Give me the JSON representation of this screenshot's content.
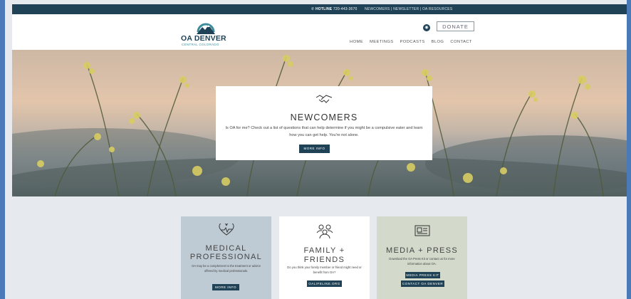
{
  "colors": {
    "navy": "#1f4257",
    "teal": "#3d8c9c",
    "frame": "#4a7ab8"
  },
  "topbar": {
    "hotline_label": "HOTLINE",
    "hotline_number": "720-443-3670",
    "links": [
      "NEWCOMERS",
      "NEWSLETTER",
      "OA RESOURCES"
    ],
    "separator": "|"
  },
  "header": {
    "logo_title": "OA DENVER",
    "logo_subtitle": "CENTRAL COLORADO",
    "donate_label": "DONATE",
    "nav": [
      "HOME",
      "MEETINGS",
      "PODCASTS",
      "BLOG",
      "CONTACT"
    ],
    "rss_icon": "rss-icon"
  },
  "hero": {
    "icon": "handshake-icon",
    "title": "NEWCOMERS",
    "text": "Is OA for me? Check out a list of questions that can help determine if you might be a compulsive eater and learn how you can get help. You're not alone.",
    "button": "MORE INFO"
  },
  "boxes": [
    {
      "icon": "heartbeat-icon",
      "title_line1": "MEDICAL",
      "title_line2": "PROFESSIONAL",
      "text": "OA may be a complement to the treatment or advice offered by medical professionals.",
      "buttons": [
        "MORE INFO"
      ]
    },
    {
      "icon": "people-group-icon",
      "title_line1": "FAMILY +",
      "title_line2": "FRIENDS",
      "text": "Do you think your family member or friend might need or benefit from OA?",
      "buttons": [
        "OALIFELINE.ORG"
      ]
    },
    {
      "icon": "newspaper-icon",
      "title_line1": "MEDIA + PRESS",
      "title_line2": "",
      "text": "Download the OA Press Kit or contact us for more information about OA.",
      "buttons": [
        "MEDIA PRESS KIT",
        "CONTACT OA DENVER"
      ]
    }
  ]
}
